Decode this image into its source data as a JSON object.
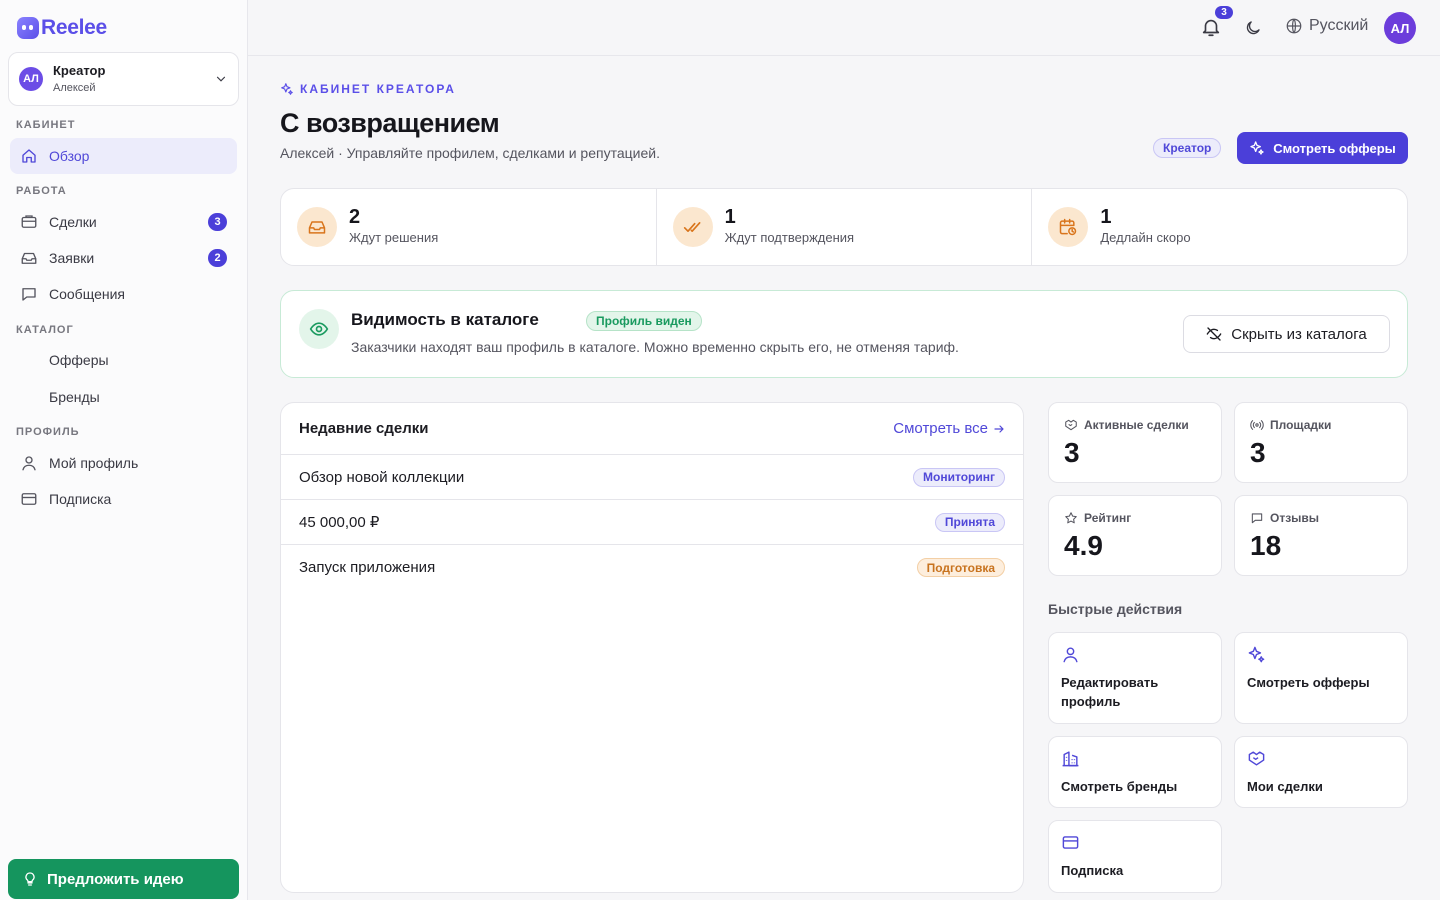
{
  "app": {
    "logo_text": "Reelee",
    "brand_color": "#5b4fe8"
  },
  "sidebar": {
    "account": {
      "initials": "АЛ",
      "role": "Креатор",
      "name": "Алексей"
    },
    "sections": [
      "КАБИНЕТ",
      "РАБОТА",
      "КАТАЛОГ",
      "ПРОФИЛЬ"
    ],
    "items": [
      {
        "label": "Обзор",
        "icon": "home-icon",
        "active": true
      },
      {
        "label": "Сделки",
        "icon": "handshake-icon",
        "badge": "3"
      },
      {
        "label": "Заявки",
        "icon": "inbox-icon",
        "badge": "2"
      },
      {
        "label": "Сообщения",
        "icon": "message-icon"
      },
      {
        "label": "Офферы",
        "icon": "tag-icon"
      },
      {
        "label": "Бренды",
        "icon": "building-icon"
      },
      {
        "label": "Мой профиль",
        "icon": "user-icon"
      },
      {
        "label": "Подписка",
        "icon": "credit-card-icon"
      }
    ],
    "idea_button": "Предложить идею"
  },
  "topbar": {
    "notifications_count": "3",
    "language": "Русский",
    "avatar_initials": "АЛ"
  },
  "header": {
    "eyebrow": "КАБИНЕТ КРЕАТОРА",
    "title": "С возвращением",
    "subtitle": "Алексей · Управляйте профилем, сделками и репутацией.",
    "role_pill": "Креатор",
    "primary_button": "Смотреть офферы"
  },
  "stats": [
    {
      "value": "2",
      "label": "Ждут решения",
      "icon": "inbox-icon"
    },
    {
      "value": "1",
      "label": "Ждут подтверждения",
      "icon": "double-check-icon"
    },
    {
      "value": "1",
      "label": "Дедлайн скоро",
      "icon": "calendar-clock-icon"
    }
  ],
  "visibility": {
    "title": "Видимость в каталоге",
    "status": "Профиль виден",
    "description": "Заказчики находят ваш профиль в каталоге. Можно временно скрыть его, не отменяя тариф.",
    "button": "Скрыть из каталога"
  },
  "deals": {
    "title": "Недавние сделки",
    "link": "Смотреть все",
    "rows": [
      {
        "name": "Обзор новой коллекции",
        "status": "Мониторинг"
      },
      {
        "name": "45 000,00 ₽",
        "status": "Принята"
      },
      {
        "name": "Запуск приложения",
        "status": "Подготовка"
      }
    ]
  },
  "mini_stats": [
    {
      "label": "Активные сделки",
      "value": "3",
      "icon": "handshake-icon"
    },
    {
      "label": "Площадки",
      "value": "3",
      "icon": "broadcast-icon"
    },
    {
      "label": "Рейтинг",
      "value": "4.9",
      "icon": "star-icon"
    },
    {
      "label": "Отзывы",
      "value": "18",
      "icon": "message-icon"
    }
  ],
  "quick_actions": {
    "title": "Быстрые действия",
    "items": [
      {
        "label": "Редактировать профиль",
        "icon": "user-icon"
      },
      {
        "label": "Смотреть офферы",
        "icon": "sparkles-icon"
      },
      {
        "label": "Смотреть бренды",
        "icon": "building-icon"
      },
      {
        "label": "Мои сделки",
        "icon": "handshake-icon"
      },
      {
        "label": "Подписка",
        "icon": "credit-card-icon"
      }
    ]
  }
}
